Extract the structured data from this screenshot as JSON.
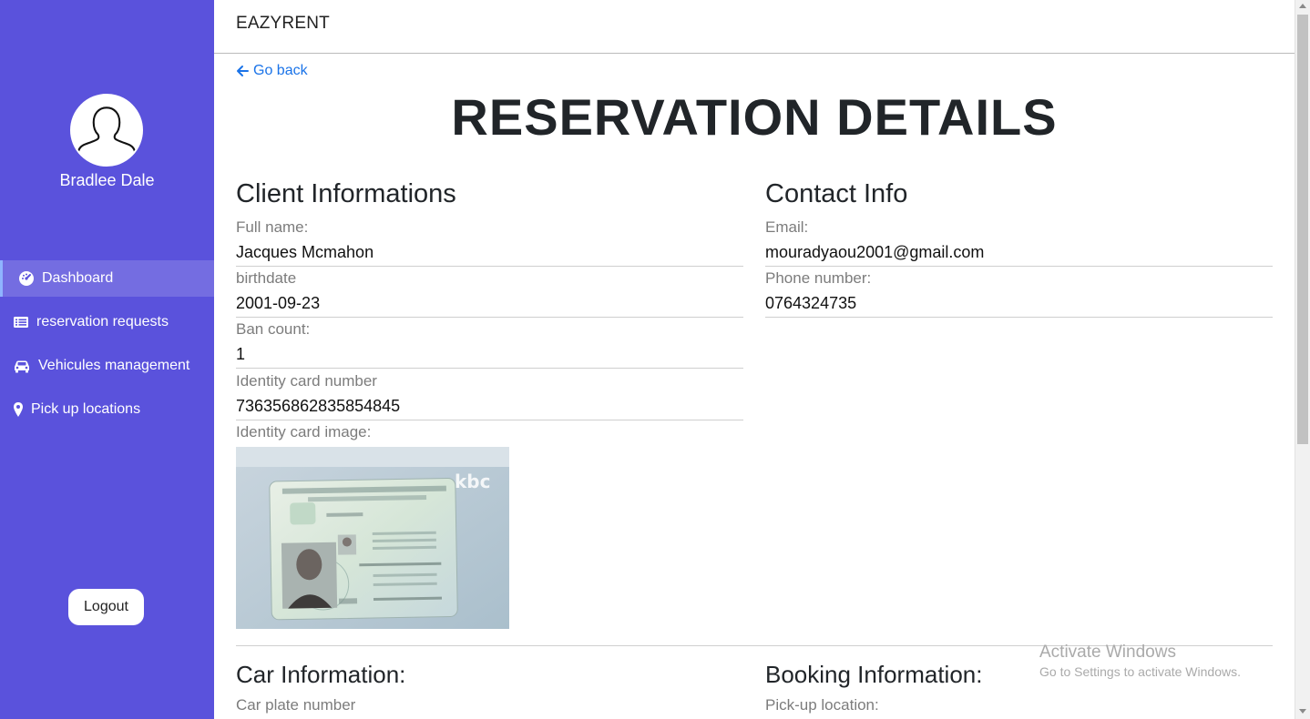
{
  "sidebar": {
    "user_name": "Bradlee Dale",
    "items": [
      {
        "label": "Dashboard",
        "icon": "dashboard-gauge-icon"
      },
      {
        "label": "reservation requests",
        "icon": "list-icon"
      },
      {
        "label": "Vehicules management",
        "icon": "car-icon"
      },
      {
        "label": "Pick up locations",
        "icon": "map-marker-icon"
      }
    ],
    "logout_label": "Logout"
  },
  "header": {
    "brand": "EAZYRENT"
  },
  "main": {
    "go_back": "Go back",
    "title": "RESERVATION DETAILS",
    "client": {
      "heading": "Client Informations",
      "full_name_label": "Full name:",
      "full_name": "Jacques Mcmahon",
      "birthdate_label": "birthdate",
      "birthdate": "2001-09-23",
      "ban_count_label": "Ban count:",
      "ban_count": "1",
      "id_number_label": "Identity card number",
      "id_number": "736356862835854845",
      "id_image_label": "Identity card image:"
    },
    "contact": {
      "heading": "Contact Info",
      "email_label": "Email:",
      "email": "mouradyaou2001@gmail.com",
      "phone_label": "Phone number:",
      "phone": "0764324735"
    },
    "car": {
      "heading": "Car Information:",
      "plate_label": "Car plate number"
    },
    "booking": {
      "heading": "Booking Information:",
      "pickup_label": "Pick-up location:"
    }
  },
  "watermark": {
    "line1": "Activate Windows",
    "line2": "Go to Settings to activate Windows."
  },
  "colors": {
    "sidebar_bg": "#5a52dc",
    "link": "#1a73e8"
  }
}
